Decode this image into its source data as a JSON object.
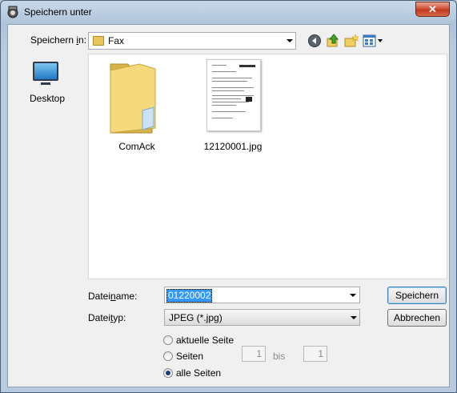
{
  "window": {
    "title": "Speichern unter",
    "close_glyph": "✕"
  },
  "location": {
    "label_pre": "Speichern ",
    "label_ul": "i",
    "label_post": "n:",
    "current": "Fax"
  },
  "toolbar": {
    "icons": [
      "back-icon",
      "up-folder-icon",
      "new-folder-icon",
      "view-menu-icon"
    ]
  },
  "places": [
    {
      "label": "Desktop",
      "icon": "desktop-icon"
    }
  ],
  "files": [
    {
      "name": "ComAck",
      "type": "folder"
    },
    {
      "name": "12120001.jpg",
      "type": "image"
    }
  ],
  "filename": {
    "label_pre": "Datei",
    "label_ul": "n",
    "label_post": "ame:",
    "value": "01220002"
  },
  "filetype": {
    "label_pre": "Datei",
    "label_ul": "t",
    "label_post": "yp:",
    "value": "JPEG (*.jpg)"
  },
  "buttons": {
    "save": "Speichern",
    "cancel": "Abbrechen"
  },
  "options": {
    "current_page": "aktuelle Seite",
    "pages": "Seiten",
    "from": "1",
    "to_label": "bis",
    "to": "1",
    "all_pages": "alle Seiten",
    "selected": "alle Seiten"
  }
}
